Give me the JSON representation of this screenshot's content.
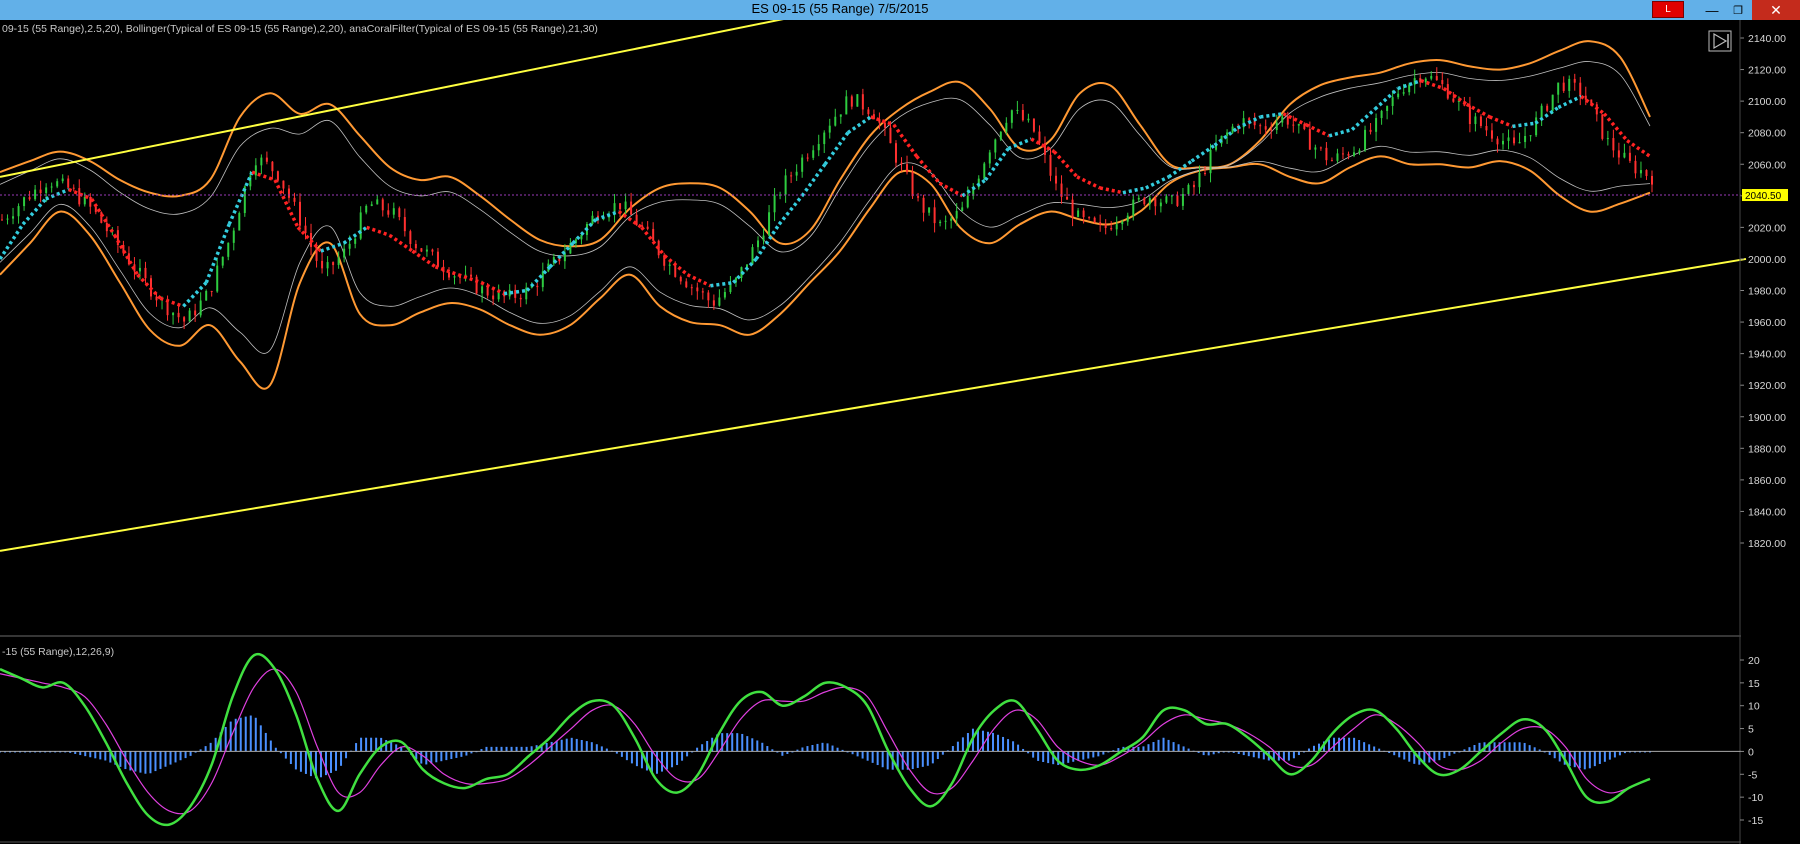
{
  "window": {
    "title": "ES 09-15 (55 Range)  7/5/2015",
    "alert_label": "L",
    "minimize_glyph": "—",
    "maximize_glyph": "❐",
    "close_glyph": "✕"
  },
  "price_panel": {
    "indicator_legend": "09-15 (55 Range),2.5,20), Bollinger(Typical of ES 09-15 (55 Range),2,20), anaCoralFilter(Typical of ES 09-15 (55 Range),21,30)",
    "current_price_label": "2040.50"
  },
  "macd_panel": {
    "indicator_legend": "-15 (55 Range),12,26,9)"
  },
  "chart_data": [
    {
      "type": "line",
      "panel": "price",
      "ylim": [
        1815,
        2145
      ],
      "y_ticks": [
        1820,
        1840,
        1860,
        1880,
        1900,
        1920,
        1940,
        1960,
        1980,
        2000,
        2020,
        2040,
        2060,
        2080,
        2100,
        2120,
        2140
      ],
      "y_tick_labels": [
        "1820.00",
        "1840.00",
        "1860.00",
        "1880.00",
        "1900.00",
        "1920.00",
        "1940.00",
        "1960.00",
        "1980.00",
        "2000.00",
        "2020.00",
        "2040.00",
        "2060.00",
        "2080.00",
        "2100.00",
        "2120.00",
        "2140.00"
      ],
      "grid": false,
      "current_price": 2040.5,
      "colors": {
        "candles_up": "#2ecc40",
        "candles_down": "#ff3030",
        "outer_band": "#ff9933",
        "inner_band": "#c0c0c0",
        "coral_up": "#33ccdd",
        "coral_down": "#ff2222",
        "coral_flat": "#ffee33",
        "trendline": "#ffff40",
        "price_line": "#9a3ab8"
      },
      "x_points": 49,
      "price_series": [
        2025,
        2038,
        2050,
        2044,
        2030,
        2010,
        1990,
        1972,
        1960,
        1978,
        2015,
        2065,
        2055,
        2025,
        1990,
        2005,
        2035,
        2030,
        2010,
        1998,
        1988,
        1980,
        1975,
        1980,
        1996,
        2012,
        2030,
        2035,
        2018,
        1998,
        1984,
        1972,
        1985,
        2012,
        2045,
        2065,
        2085,
        2102,
        2094,
        2065,
        2035,
        2020,
        2032,
        2068,
        2095,
        2082,
        2045,
        2025,
        2018,
        2030,
        2040,
        2035,
        2045,
        2072,
        2088,
        2083,
        2090,
        2075,
        2062,
        2070,
        2085,
        2108,
        2118,
        2108,
        2090,
        2080,
        2070,
        2088,
        2112,
        2105,
        2075,
        2060,
        2052
      ],
      "outer_upper": [
        2055,
        2062,
        2068,
        2062,
        2050,
        2042,
        2040,
        2050,
        2090,
        2105,
        2092,
        2098,
        2078,
        2058,
        2050,
        2052,
        2040,
        2025,
        2012,
        2008,
        2012,
        2032,
        2045,
        2048,
        2045,
        2030,
        2010,
        2018,
        2050,
        2078,
        2095,
        2106,
        2112,
        2095,
        2070,
        2075,
        2105,
        2110,
        2085,
        2060,
        2058,
        2060,
        2075,
        2098,
        2110,
        2115,
        2118,
        2124,
        2126,
        2122,
        2120,
        2124,
        2132,
        2138,
        2128,
        2090
      ],
      "outer_lower": [
        1990,
        2010,
        2030,
        2015,
        1985,
        1955,
        1945,
        1958,
        1935,
        1920,
        1985,
        2010,
        1965,
        1958,
        1966,
        1972,
        1968,
        1958,
        1952,
        1958,
        1975,
        1990,
        1970,
        1960,
        1958,
        1952,
        1965,
        1985,
        2005,
        2032,
        2055,
        2048,
        2020,
        2010,
        2022,
        2030,
        2025,
        2022,
        2030,
        2048,
        2056,
        2058,
        2060,
        2052,
        2048,
        2058,
        2065,
        2060,
        2060,
        2058,
        2062,
        2056,
        2040,
        2030,
        2035,
        2042
      ],
      "coral_filter": [
        2000,
        2022,
        2038,
        2044,
        2038,
        2015,
        1990,
        1975,
        1970,
        1985,
        2022,
        2055,
        2050,
        2020,
        2005,
        2010,
        2020,
        2015,
        2005,
        1995,
        1990,
        1985,
        1978,
        1980,
        1995,
        2010,
        2025,
        2030,
        2020,
        2002,
        1990,
        1983,
        1985,
        2000,
        2022,
        2040,
        2060,
        2080,
        2090,
        2085,
        2065,
        2048,
        2040,
        2050,
        2070,
        2076,
        2068,
        2052,
        2045,
        2042,
        2045,
        2052,
        2062,
        2072,
        2083,
        2090,
        2092,
        2085,
        2078,
        2082,
        2095,
        2108,
        2113,
        2108,
        2098,
        2090,
        2084,
        2086,
        2096,
        2103,
        2092,
        2075,
        2065
      ],
      "trendlines": [
        {
          "x": [
            0,
            0.47
          ],
          "y": [
            2052,
            2160
          ]
        },
        {
          "x": [
            0,
            0.97
          ],
          "y": [
            1815,
            2000
          ]
        }
      ]
    },
    {
      "type": "bar",
      "panel": "macd",
      "ylim": [
        -18,
        22
      ],
      "y_ticks": [
        -15,
        -10,
        -5,
        0,
        5,
        10,
        15,
        20
      ],
      "y_tick_labels": [
        "-15",
        "-10",
        "-5",
        "0",
        "5",
        "10",
        "15",
        "20"
      ],
      "series": [
        {
          "values": [
            18,
            16,
            14,
            15,
            10,
            2,
            -7,
            -14,
            -16,
            -12,
            -3,
            12,
            21,
            18,
            8,
            -6,
            -13,
            -5,
            1,
            2,
            -4,
            -7,
            -8,
            -6,
            -5,
            -1,
            3,
            8,
            11,
            10,
            3,
            -6,
            -9,
            -5,
            4,
            11,
            13,
            10,
            12,
            15,
            14,
            10,
            0,
            -8,
            -12,
            -7,
            3,
            9,
            11,
            5,
            -2,
            -4,
            -3,
            0,
            3,
            9,
            9,
            6,
            6,
            3,
            -1,
            -5,
            -2,
            4,
            8,
            9,
            5,
            -1,
            -5,
            -4,
            0,
            4,
            7,
            5,
            -2,
            -10,
            -11,
            -8,
            -6
          ]
        },
        {
          "values": [
            17,
            16,
            15,
            14,
            12,
            6,
            -2,
            -9,
            -13,
            -13,
            -7,
            4,
            14,
            18,
            13,
            1,
            -9,
            -9,
            -3,
            1,
            -1,
            -5,
            -7,
            -7,
            -6,
            -3,
            1,
            5,
            9,
            10,
            6,
            -1,
            -6,
            -6,
            0,
            7,
            11,
            11,
            11,
            13,
            14,
            12,
            4,
            -4,
            -9,
            -8,
            -2,
            5,
            9,
            7,
            1,
            -2,
            -3,
            -1,
            2,
            6,
            8,
            7,
            6,
            4,
            1,
            -3,
            -3,
            1,
            5,
            8,
            6,
            2,
            -3,
            -4,
            -2,
            2,
            5,
            5,
            1,
            -6,
            -9,
            -8,
            -6
          ]
        },
        {
          "values": [
            0,
            0,
            0,
            0,
            -1,
            -2,
            -4,
            -5,
            -3,
            -1,
            2,
            7,
            8,
            1,
            -4,
            -6,
            -4,
            3,
            3,
            1,
            -3,
            -2,
            -1,
            1,
            1,
            1,
            2,
            3,
            2,
            0,
            -3,
            -5,
            -3,
            1,
            4,
            4,
            2,
            -1,
            1,
            2,
            0,
            -2,
            -4,
            -4,
            -3,
            1,
            5,
            4,
            2,
            -2,
            -3,
            -2,
            -1,
            1,
            1,
            3,
            1,
            -1,
            0,
            -1,
            -2,
            -2,
            1,
            3,
            3,
            1,
            -1,
            -3,
            -2,
            0,
            2,
            2,
            2,
            0,
            -3,
            -4,
            -2,
            0,
            0
          ]
        }
      ]
    }
  ]
}
